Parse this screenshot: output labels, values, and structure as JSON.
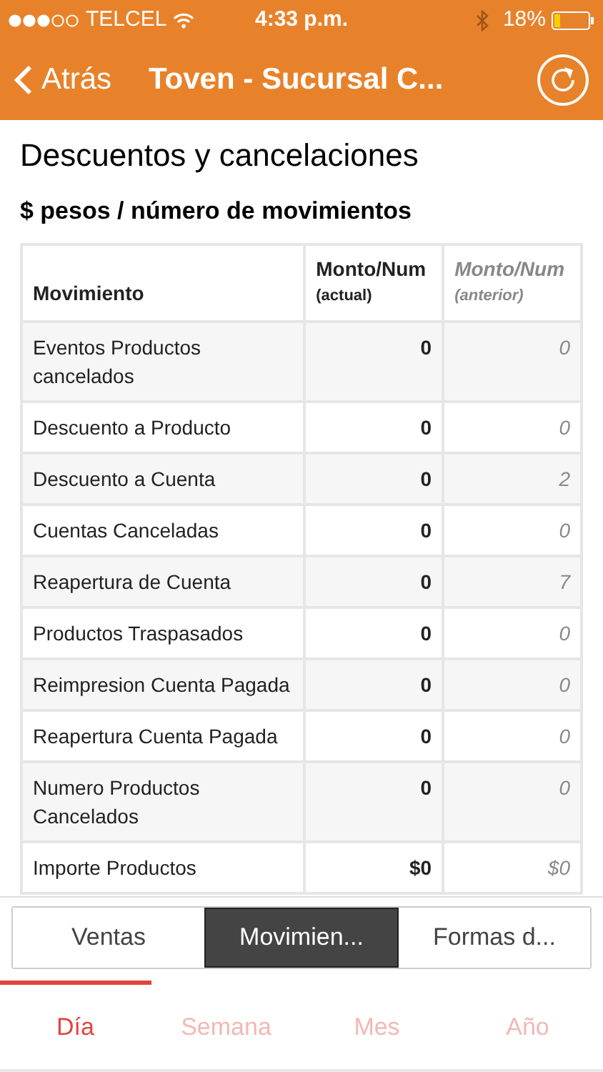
{
  "status_bar": {
    "carrier": "TELCEL",
    "time": "4:33 p.m.",
    "battery": "18%"
  },
  "nav": {
    "back": "Atrás",
    "title": "Toven - Sucursal C..."
  },
  "title": "Descuentos y cancelaciones",
  "subtitle": "$ pesos / número de movimientos",
  "table": {
    "columns": [
      {
        "label": "Movimiento"
      },
      {
        "label": "Monto/Num",
        "sublabel": "(actual)"
      },
      {
        "label": "Monto/Num",
        "sublabel": "(anterior)"
      }
    ],
    "rows": [
      {
        "movimiento": "Eventos Productos cancelados",
        "actual": "0",
        "anterior": "0"
      },
      {
        "movimiento": "Descuento a Producto",
        "actual": "0",
        "anterior": "0"
      },
      {
        "movimiento": "Descuento a Cuenta",
        "actual": "0",
        "anterior": "2"
      },
      {
        "movimiento": "Cuentas Canceladas",
        "actual": "0",
        "anterior": "0"
      },
      {
        "movimiento": "Reapertura de Cuenta",
        "actual": "0",
        "anterior": "7"
      },
      {
        "movimiento": "Productos Traspasados",
        "actual": "0",
        "anterior": "0"
      },
      {
        "movimiento": "Reimpresion Cuenta Pagada",
        "actual": "0",
        "anterior": "0"
      },
      {
        "movimiento": "Reapertura Cuenta Pagada",
        "actual": "0",
        "anterior": "0"
      },
      {
        "movimiento": "Numero Productos Cancelados",
        "actual": "0",
        "anterior": "0"
      },
      {
        "movimiento": "Importe Productos",
        "actual": "$0",
        "anterior": "$0"
      }
    ]
  },
  "segments": [
    {
      "label": "Ventas",
      "selected": false
    },
    {
      "label": "Movimien...",
      "selected": true
    },
    {
      "label": "Formas d...",
      "selected": false
    }
  ],
  "period_tabs": [
    {
      "label": "Día",
      "selected": true
    },
    {
      "label": "Semana",
      "selected": false
    },
    {
      "label": "Mes",
      "selected": false
    },
    {
      "label": "Año",
      "selected": false
    }
  ]
}
